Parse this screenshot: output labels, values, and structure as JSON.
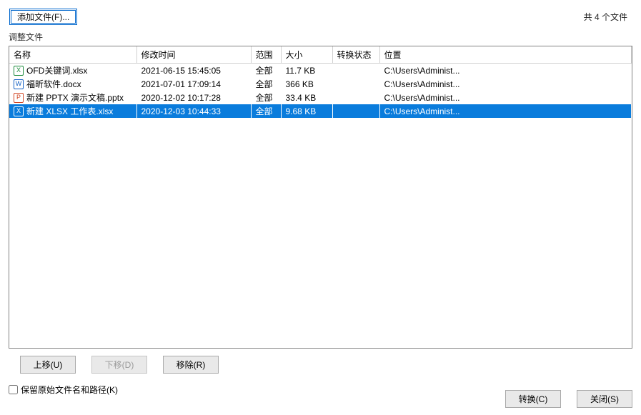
{
  "header": {
    "add_file_label": "添加文件(F)...",
    "file_count_label": "共 4 个文件"
  },
  "section_label": "调整文件",
  "columns": {
    "name": "名称",
    "modified": "修改时间",
    "range": "范围",
    "size": "大小",
    "status": "转换状态",
    "location": "位置"
  },
  "rows": [
    {
      "icon": "xlsx",
      "name": "OFD关键词.xlsx",
      "modified": "2021-06-15 15:45:05",
      "range": "全部",
      "size": "11.7 KB",
      "status": "",
      "location": "C:\\Users\\Administ...",
      "selected": false
    },
    {
      "icon": "docx",
      "name": "福昕软件.docx",
      "modified": "2021-07-01 17:09:14",
      "range": "全部",
      "size": "366 KB",
      "status": "",
      "location": "C:\\Users\\Administ...",
      "selected": false
    },
    {
      "icon": "pptx",
      "name": "新建 PPTX 演示文稿.pptx",
      "modified": "2020-12-02 10:17:28",
      "range": "全部",
      "size": "33.4 KB",
      "status": "",
      "location": "C:\\Users\\Administ...",
      "selected": false
    },
    {
      "icon": "xlsx",
      "name": "新建 XLSX 工作表.xlsx",
      "modified": "2020-12-03 10:44:33",
      "range": "全部",
      "size": "9.68 KB",
      "status": "",
      "location": "C:\\Users\\Administ...",
      "selected": true
    }
  ],
  "buttons": {
    "move_up": "上移(U)",
    "move_down": "下移(D)",
    "remove": "移除(R)"
  },
  "checkbox": {
    "keep_path_label": "保留原始文件名和路径(K)"
  },
  "footer": {
    "convert": "转换(C)",
    "close": "关闭(S)"
  },
  "icon_glyphs": {
    "xlsx": "X",
    "docx": "W",
    "pptx": "P"
  }
}
